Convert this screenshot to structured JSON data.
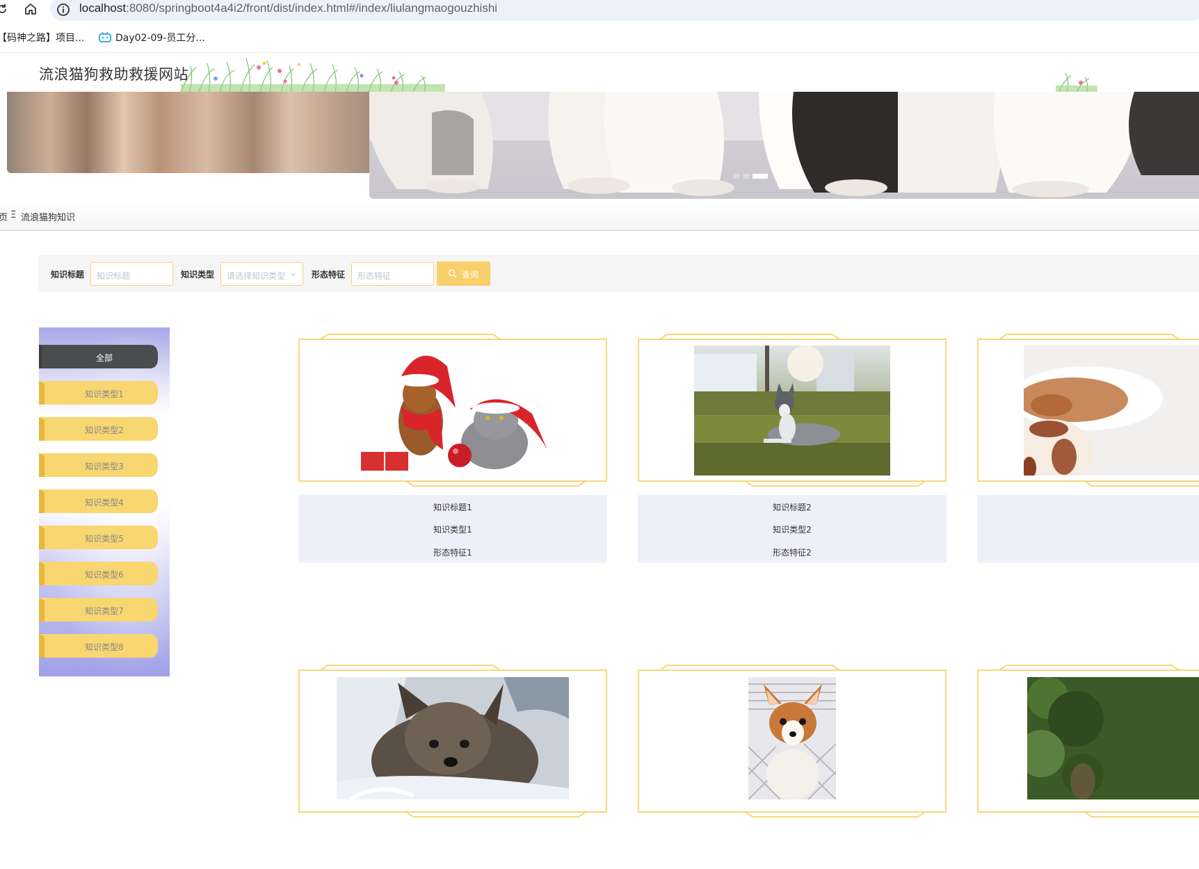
{
  "browser": {
    "url_host": "localhost",
    "url_rest": ":8080/springboot4a4i2/front/dist/index.html#/index/liulangmaogouzhishi",
    "bookmarks": [
      "【码神之路】项目...",
      "Day02-09-员工分..."
    ]
  },
  "site": {
    "title": "流浪猫狗救助救援网站"
  },
  "breadcrumb": {
    "home": "页",
    "separator": "Ξ",
    "current": "流浪猫狗知识"
  },
  "search": {
    "title_label": "知识标题",
    "title_placeholder": "知识标题",
    "type_label": "知识类型",
    "type_placeholder": "请选择知识类型",
    "feature_label": "形态特征",
    "feature_placeholder": "形态特征",
    "button_label": "查询"
  },
  "categories": [
    "全部",
    "知识类型1",
    "知识类型2",
    "知识类型3",
    "知识类型4",
    "知识类型5",
    "知识类型6",
    "知识类型7",
    "知识类型8"
  ],
  "active_category": "全部",
  "cards": [
    {
      "title": "知识标题1",
      "type": "知识类型1",
      "feature": "形态特征1",
      "image": "dog-and-cat-christmas-hats"
    },
    {
      "title": "知识标题2",
      "type": "知识类型2",
      "feature": "形态特征2",
      "image": "husky-lying-on-grass"
    },
    {
      "title": "",
      "type": "",
      "feature": "",
      "image": "spotted-puppy-partial"
    },
    {
      "title": "",
      "type": "",
      "feature": "",
      "image": "yorkie-puppy-on-blanket"
    },
    {
      "title": "",
      "type": "",
      "feature": "",
      "image": "chihuahua-in-wicker-chair"
    },
    {
      "title": "",
      "type": "",
      "feature": "",
      "image": "dog-in-green-foliage-partial"
    }
  ],
  "colors": {
    "accent_yellow": "#f8d06b",
    "card_info_bg": "#efeffb",
    "active_tab": "#4a4c4e"
  }
}
